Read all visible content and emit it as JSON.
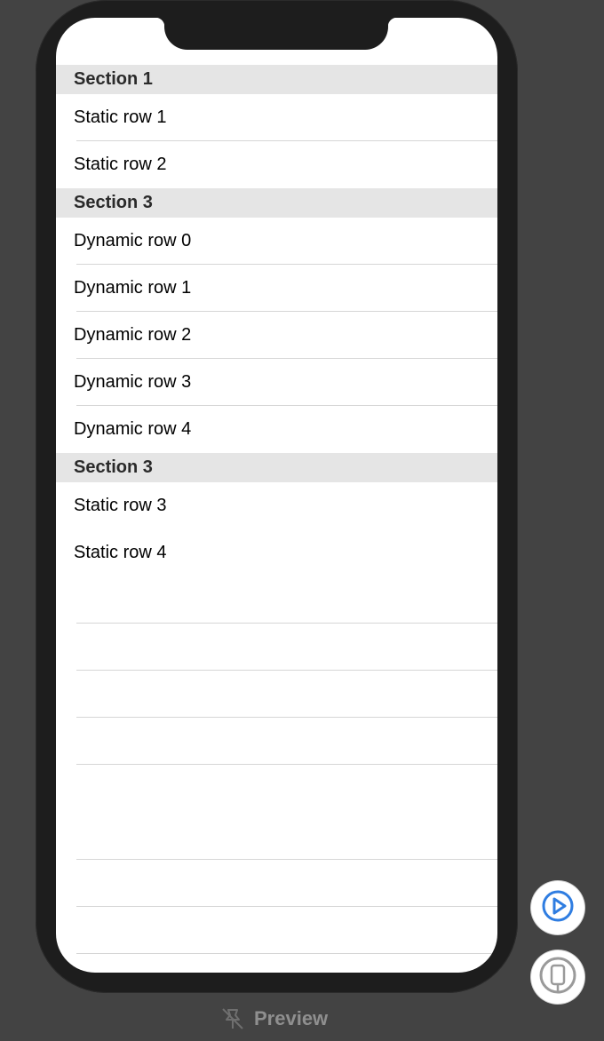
{
  "table": {
    "sections": [
      {
        "header": "Section 1",
        "rows": [
          "Static row 1",
          "Static row 2"
        ]
      },
      {
        "header": "Section 3",
        "rows": [
          "Dynamic row 0",
          "Dynamic row 1",
          "Dynamic row 2",
          "Dynamic row 3",
          "Dynamic row 4"
        ]
      },
      {
        "header": "Section 3",
        "rows": [
          "Static row 3",
          "Static row 4"
        ]
      }
    ]
  },
  "preview": {
    "label": "Preview"
  },
  "icons": {
    "play": "play-icon",
    "device": "device-icon",
    "pin": "pin-slash-icon"
  },
  "colors": {
    "accent": "#2f7de1",
    "canvas": "#434343",
    "device_frame": "#1d1d1d",
    "section_header_bg": "#e5e5e5"
  }
}
